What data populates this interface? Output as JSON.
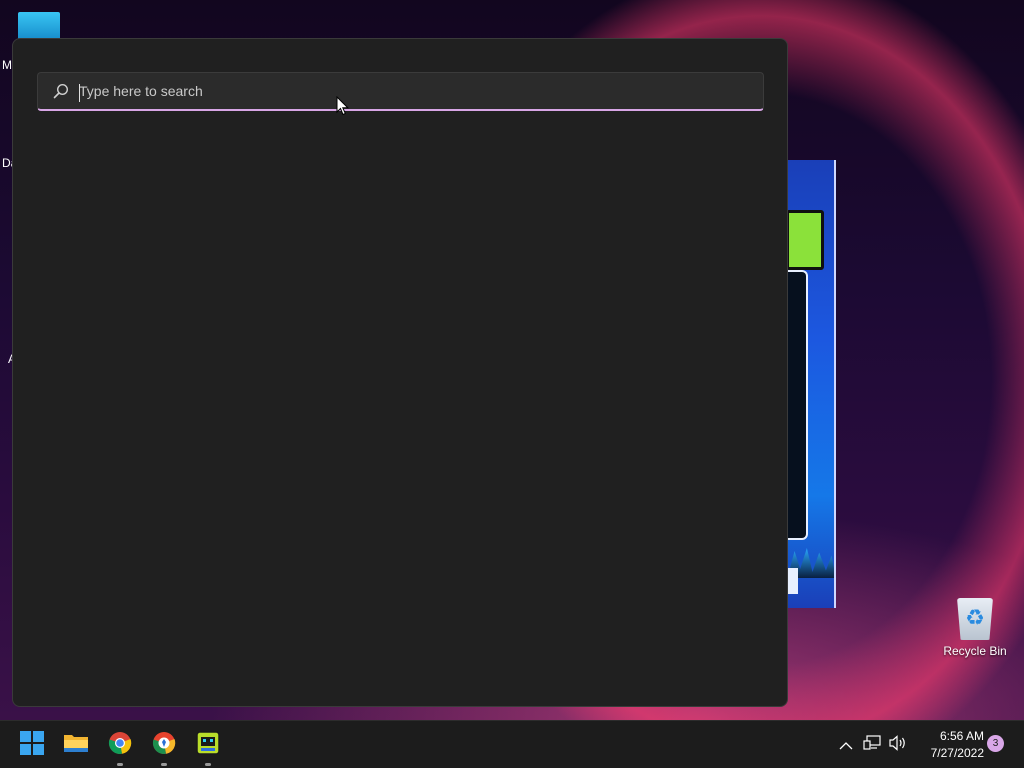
{
  "desktop": {
    "edge_labels": [
      "M",
      "Da",
      "A"
    ],
    "recycle_bin_label": "Recycle Bin"
  },
  "search": {
    "placeholder": "Type here to search",
    "value": ""
  },
  "taskbar": {
    "apps": [
      {
        "name": "start",
        "icon": "windows-logo-icon"
      },
      {
        "name": "file-explorer",
        "icon": "folder-icon"
      },
      {
        "name": "chrome",
        "icon": "chrome-icon"
      },
      {
        "name": "brave",
        "icon": "browser-icon"
      },
      {
        "name": "game",
        "icon": "game-icon"
      }
    ],
    "tray": {
      "time": "6:56 AM",
      "date": "7/27/2022",
      "notification_count": "3"
    }
  },
  "colors": {
    "accent": "#d8a6e6",
    "panel_bg": "#202020",
    "taskbar_bg": "#1c1c1c",
    "windows_blue": "#0078d4"
  }
}
